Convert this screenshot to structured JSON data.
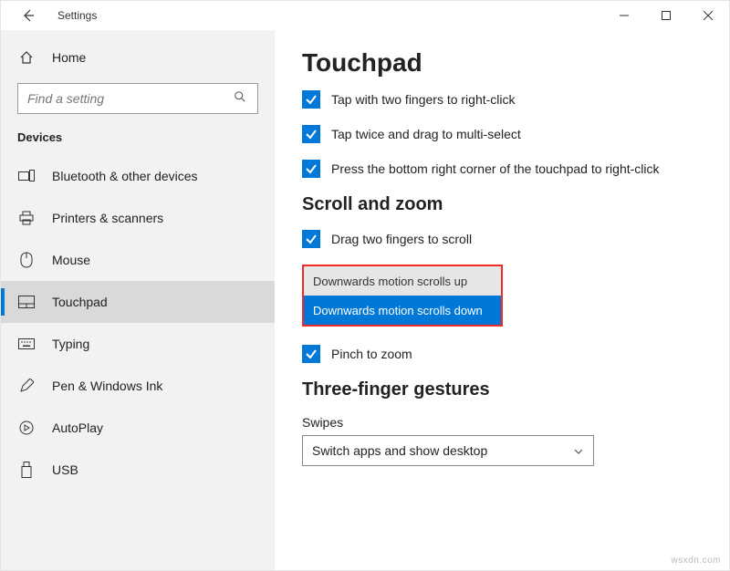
{
  "window": {
    "title": "Settings"
  },
  "sidebar": {
    "home": "Home",
    "search_placeholder": "Find a setting",
    "category": "Devices",
    "items": [
      {
        "label": "Bluetooth & other devices"
      },
      {
        "label": "Printers & scanners"
      },
      {
        "label": "Mouse"
      },
      {
        "label": "Touchpad"
      },
      {
        "label": "Typing"
      },
      {
        "label": "Pen & Windows Ink"
      },
      {
        "label": "AutoPlay"
      },
      {
        "label": "USB"
      }
    ]
  },
  "content": {
    "title": "Touchpad",
    "checks": {
      "tap_two_right": "Tap with two fingers to right-click",
      "tap_twice_drag": "Tap twice and drag to multi-select",
      "bottom_right": "Press the bottom right corner of the touchpad to right-click",
      "drag_two_scroll": "Drag two fingers to scroll",
      "pinch_zoom": "Pinch to zoom"
    },
    "scroll_zoom_title": "Scroll and zoom",
    "scroll_dropdown": {
      "option_up": "Downwards motion scrolls up",
      "option_down": "Downwards motion scrolls down"
    },
    "three_finger_title": "Three-finger gestures",
    "swipes_label": "Swipes",
    "swipes_value": "Switch apps and show desktop"
  },
  "watermark": "wsxdn.com"
}
